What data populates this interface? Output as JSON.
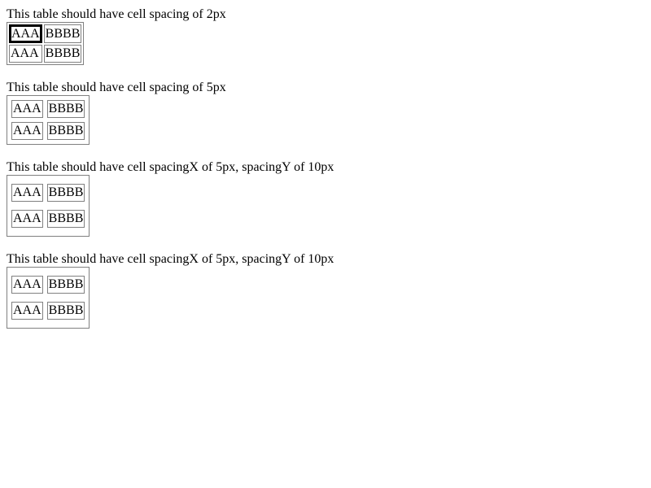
{
  "sections": [
    {
      "caption": "This table should have cell spacing of 2px",
      "rows": [
        [
          "AAA",
          "BBBB"
        ],
        [
          "AAA",
          "BBBB"
        ]
      ]
    },
    {
      "caption": "This table should have cell spacing of 5px",
      "rows": [
        [
          "AAA",
          "BBBB"
        ],
        [
          "AAA",
          "BBBB"
        ]
      ]
    },
    {
      "caption": "This table should have cell spacingX of 5px, spacingY of 10px",
      "rows": [
        [
          "AAA",
          "BBBB"
        ],
        [
          "AAA",
          "BBBB"
        ]
      ]
    },
    {
      "caption": "This table should have cell spacingX of 5px, spacingY of 10px",
      "rows": [
        [
          "AAA",
          "BBBB"
        ],
        [
          "AAA",
          "BBBB"
        ]
      ]
    }
  ]
}
